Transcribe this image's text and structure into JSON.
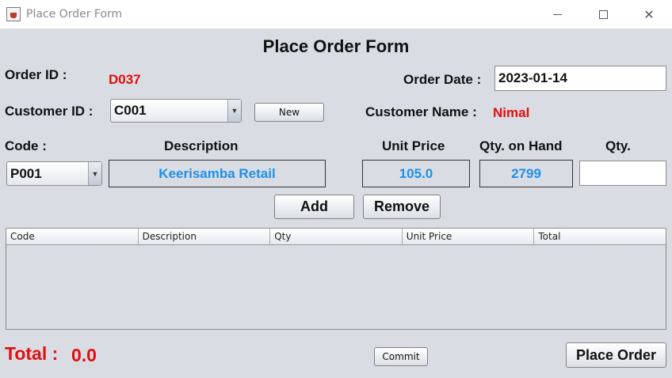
{
  "window": {
    "title": "Place Order Form"
  },
  "form": {
    "heading": "Place Order Form",
    "order_id_label": "Order ID :",
    "order_id_value": "D037",
    "order_date_label": "Order Date :",
    "order_date_value": "2023-01-14",
    "customer_id_label": "Customer ID :",
    "customer_id_selected": "C001",
    "new_button": "New",
    "customer_name_label": "Customer Name :",
    "customer_name_value": "Nimal",
    "code_label": "Code :",
    "description_label": "Description",
    "unit_price_label": "Unit Price",
    "qty_on_hand_label": "Qty. on Hand",
    "qty_label": "Qty.",
    "code_selected": "P001",
    "description_value": "Keerisamba Retail",
    "unit_price_value": "105.0",
    "qty_on_hand_value": "2799",
    "qty_value": "",
    "add_button": "Add",
    "remove_button": "Remove",
    "total_label": "Total :",
    "total_value": "0.0",
    "commit_button": "Commit",
    "place_order_button": "Place Order"
  },
  "table": {
    "columns": [
      "Code",
      "Description",
      "Qty",
      "Unit Price",
      "Total"
    ],
    "rows": []
  },
  "colors": {
    "accent_red": "#e00f0f",
    "accent_blue": "#1e90e8",
    "background": "#d9dce3"
  }
}
